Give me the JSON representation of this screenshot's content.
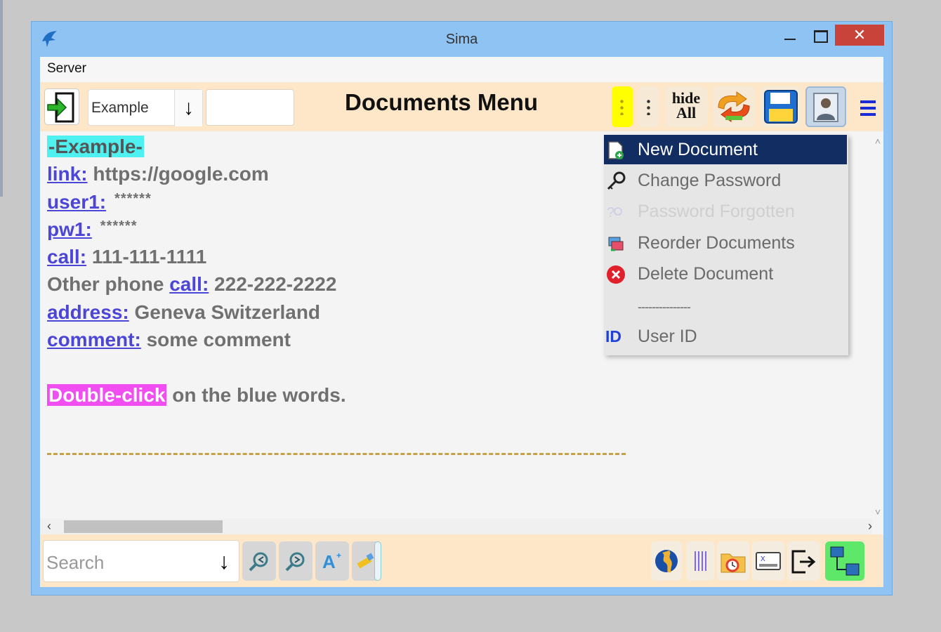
{
  "window": {
    "title": "Sima",
    "close_glyph": "✕"
  },
  "menubar": {
    "items": [
      "Server"
    ]
  },
  "toolbar": {
    "enter_icon": "enter-arrow-icon",
    "document_select": {
      "value": "Example",
      "arrow": "↓"
    },
    "title": "Documents Menu",
    "hide_all_label": "hide\nAll",
    "buttons": [
      "yellow-kebab-icon",
      "kebab-icon",
      "hide-all",
      "sync-icon",
      "save-icon",
      "user-photo-icon",
      "hamburger-icon"
    ]
  },
  "document": {
    "title": "-Example-",
    "fields": [
      {
        "label": "link:",
        "value": "https://google.com"
      },
      {
        "label": "user1:",
        "value": "******"
      },
      {
        "label": "pw1:",
        "value": "******"
      },
      {
        "label": "call:",
        "value": "111-111-1111"
      },
      {
        "prefix": "Other phone",
        "label": "call:",
        "value": "222-222-2222"
      },
      {
        "label": "address:",
        "value": "Geneva Switzerland"
      },
      {
        "label": "comment:",
        "value": "some comment"
      }
    ],
    "hint": {
      "highlight": "Double-click",
      "rest": "on the blue words."
    }
  },
  "context_menu": {
    "items": [
      {
        "label": "New Document",
        "icon": "new-document-icon",
        "selected": true
      },
      {
        "label": "Change Password",
        "icon": "key-icon"
      },
      {
        "label": "Password Forgotten",
        "icon": "key-question-icon",
        "disabled": true
      },
      {
        "label": "Reorder Documents",
        "icon": "reorder-icon"
      },
      {
        "label": "Delete Document",
        "icon": "delete-icon"
      },
      {
        "label": "---------------",
        "separator": true
      },
      {
        "label": "User ID",
        "icon_text": "ID"
      }
    ]
  },
  "bottombar": {
    "search_placeholder": "Search",
    "search_arrow": "↓"
  },
  "colors": {
    "toolbar_bg": "#fde7c8",
    "link": "#4b45d8",
    "title_highlight": "#4ff0f0",
    "hint_highlight": "#f04ef0",
    "menu_selected": "#112d61"
  }
}
